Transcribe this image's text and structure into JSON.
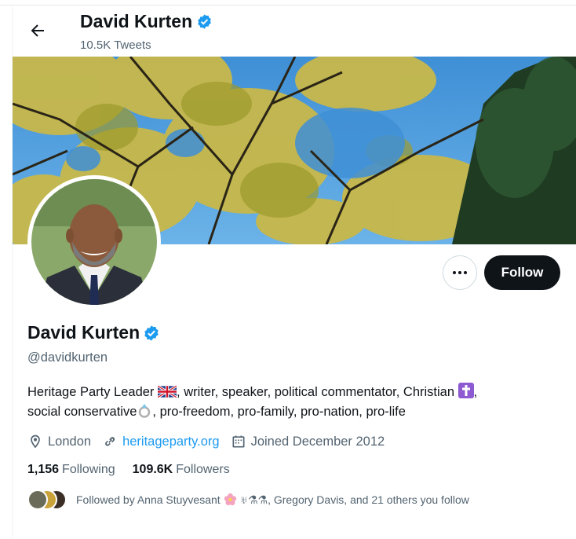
{
  "header": {
    "title": "David Kurten",
    "tweet_count": "10.5K Tweets"
  },
  "profile": {
    "name": "David Kurten",
    "handle": "@davidkurten",
    "bio_line1_a": "Heritage Party Leader",
    "bio_line1_b": ", writer, speaker, political commentator, Christian",
    "bio_line1_c": ",",
    "bio_line2_a": "social conservative",
    "bio_line2_b": ", pro-freedom, pro-family, pro-nation, pro-life",
    "location": "London",
    "website": "heritageparty.org",
    "joined": "Joined December 2012"
  },
  "actions": {
    "follow_label": "Follow"
  },
  "stats": {
    "following_count": "1,156",
    "following_label": "Following",
    "followers_count": "109.6K",
    "followers_label": "Followers"
  },
  "followed_by": {
    "text_a": "Followed by Anna Stuyvesant",
    "text_b": ", Gregory Davis, and 21 others you follow",
    "glyphs": "♅⚗⚗"
  },
  "colors": {
    "verified": "#1d9bf0",
    "follow_button": "#0f1419",
    "link": "#1d9bf0",
    "secondary_text": "#536471"
  },
  "icons": [
    "back-arrow-icon",
    "verified-badge-icon",
    "more-icon",
    "location-icon",
    "link-icon",
    "calendar-icon",
    "uk-flag-icon",
    "cross-icon",
    "ring-icon",
    "flower-icon"
  ]
}
